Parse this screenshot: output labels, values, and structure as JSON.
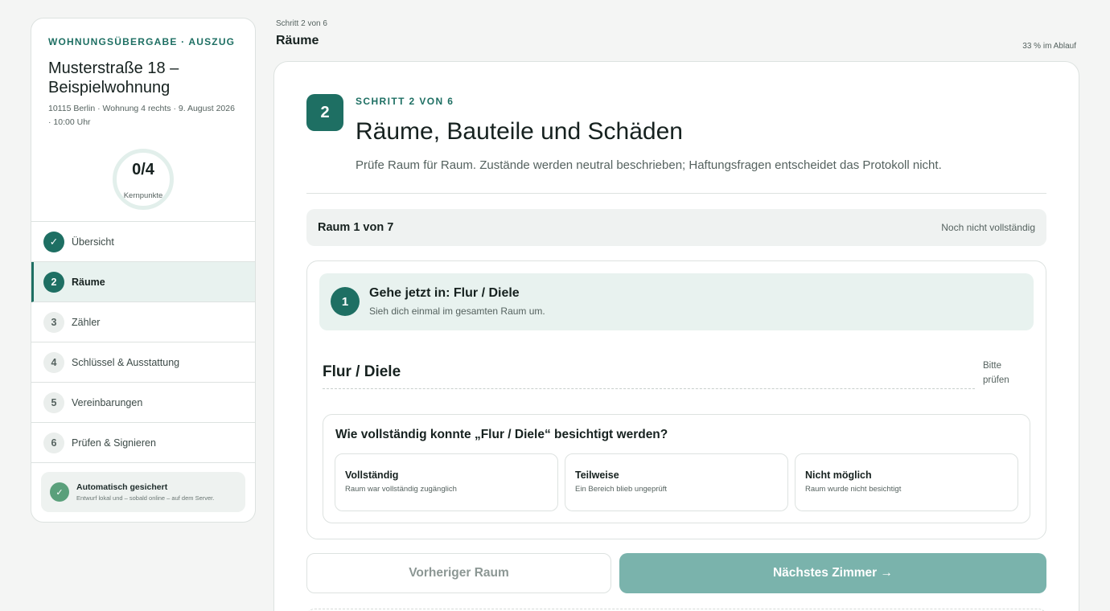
{
  "sidebar": {
    "eyebrow": "WOHNUNGSÜBERGABE · AUSZUG",
    "title": "Musterstraße 18 – Beispielwohnung",
    "meta": "10115 Berlin · Wohnung 4 rechts · 9. August 2026 · 10:00 Uhr",
    "progress": {
      "value": "0/4",
      "label": "Kernpunkte"
    },
    "nav": [
      {
        "badge": "✓",
        "label": "Übersicht",
        "state": "done"
      },
      {
        "badge": "2",
        "label": "Räume",
        "state": "current"
      },
      {
        "badge": "3",
        "label": "Zähler",
        "state": "todo"
      },
      {
        "badge": "4",
        "label": "Schlüssel & Ausstattung",
        "state": "todo"
      },
      {
        "badge": "5",
        "label": "Vereinbarungen",
        "state": "todo"
      },
      {
        "badge": "6",
        "label": "Prüfen & Signieren",
        "state": "todo"
      }
    ],
    "autosave": {
      "icon": "check-icon",
      "title": "Automatisch gesichert",
      "subtitle": "Entwurf lokal und – sobald online – auf dem Server."
    }
  },
  "header": {
    "step_label": "Schritt 2 von 6",
    "title": "Räume",
    "progress": "33 % im Ablauf"
  },
  "main": {
    "step_number": "2",
    "eyebrow": "SCHRITT 2 VON 6",
    "title": "Räume, Bauteile und Schäden",
    "description": "Prüfe Raum für Raum. Zustände werden neutral beschrieben; Haftungsfragen entscheidet das Protokoll nicht.",
    "room_bar": {
      "count": "Raum 1 von 7",
      "status": "Noch nicht vollständig"
    },
    "goto": {
      "number": "1",
      "title": "Gehe jetzt in: Flur / Diele",
      "subtitle": "Sieh dich einmal im gesamten Raum um."
    },
    "room_name": "Flur / Diele",
    "room_check": "Bitte prüfen",
    "question": {
      "text": "Wie vollständig konnte „Flur / Diele“ besichtigt werden?",
      "options": [
        {
          "title": "Vollständig",
          "subtitle": "Raum war vollständig zugänglich"
        },
        {
          "title": "Teilweise",
          "subtitle": "Ein Bereich blieb ungeprüft"
        },
        {
          "title": "Nicht möglich",
          "subtitle": "Raum wurde nicht besichtigt"
        }
      ]
    },
    "buttons": {
      "prev": "Vorheriger Raum",
      "next": "Nächstes Zimmer →"
    }
  },
  "colors": {
    "accent": "#1e6f63",
    "accent_light": "#e8f2ef",
    "next_button": "#7ab3ac",
    "autosave": "#5aa07b"
  }
}
